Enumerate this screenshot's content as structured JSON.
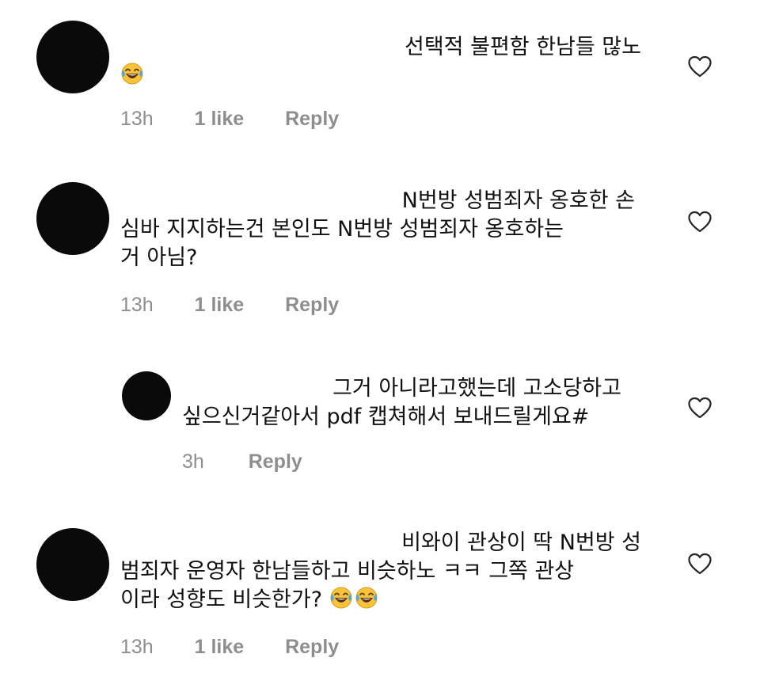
{
  "comments": [
    {
      "lines": [
        "선택적 불편함 한남들 많노"
      ],
      "emoji_count": 1,
      "time": "13h",
      "likes": "1 like",
      "reply": "Reply"
    },
    {
      "lines": [
        "N번방 성범죄자 옹호한 손",
        "심바 지지하는건 본인도 N번방 성범죄자 옹호하는",
        "거 아님?"
      ],
      "time": "13h",
      "likes": "1 like",
      "reply": "Reply"
    },
    {
      "lines": [
        "그거 아니라고했는데 고소당하고",
        "싶으신거같아서 pdf 캡쳐해서 보내드릴게요#"
      ],
      "time": "3h",
      "reply": "Reply"
    },
    {
      "lines": [
        "비와이 관상이 딱 N번방 성",
        "범죄자 운영자 한남들하고 비슷하노 ㅋㅋ 그쪽 관상",
        "이라 성향도 비슷한가?"
      ],
      "emoji_count": 2,
      "time": "13h",
      "likes": "1 like",
      "reply": "Reply"
    }
  ],
  "icons": {
    "like": "heart-outline-icon",
    "emoji": "face-with-tears-of-joy-emoji"
  },
  "colors": {
    "meta_text": "#8e8e8e",
    "avatar": "#0a0a0a"
  }
}
